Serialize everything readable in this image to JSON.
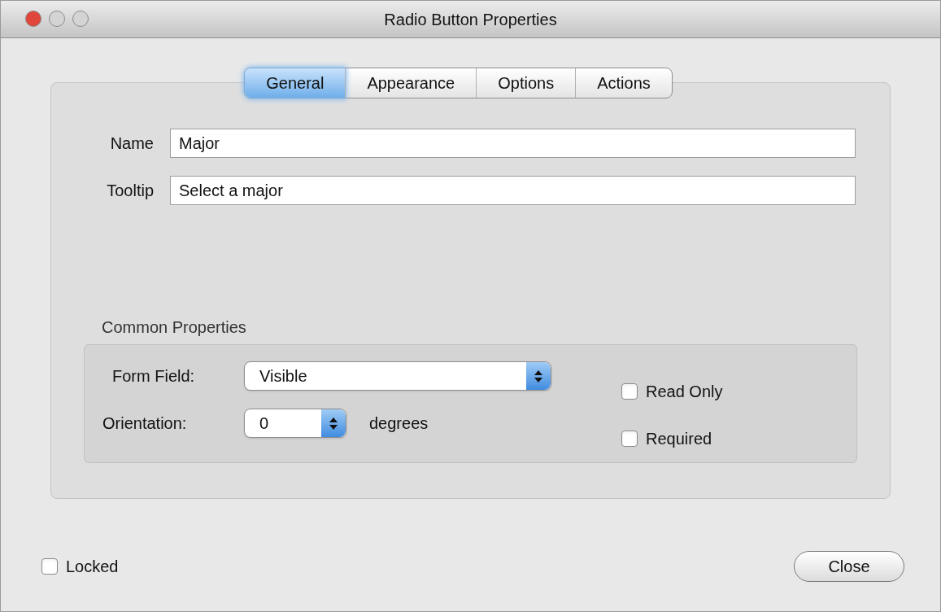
{
  "window": {
    "title": "Radio Button Properties"
  },
  "tabs": [
    {
      "label": "General",
      "selected": true
    },
    {
      "label": "Appearance",
      "selected": false
    },
    {
      "label": "Options",
      "selected": false
    },
    {
      "label": "Actions",
      "selected": false
    }
  ],
  "fields": [
    {
      "label": "Name",
      "value": "Major"
    },
    {
      "label": "Tooltip",
      "value": "Select a major"
    }
  ],
  "common_properties": {
    "title": "Common Properties",
    "form_field": {
      "label": "Form Field:",
      "value": "Visible"
    },
    "orientation": {
      "label": "Orientation:",
      "value": "0",
      "unit": "degrees"
    },
    "checkboxes": [
      {
        "label": "Read Only",
        "checked": false
      },
      {
        "label": "Required",
        "checked": false
      }
    ]
  },
  "locked": {
    "label": "Locked",
    "checked": false
  },
  "buttons": [
    "Close"
  ]
}
